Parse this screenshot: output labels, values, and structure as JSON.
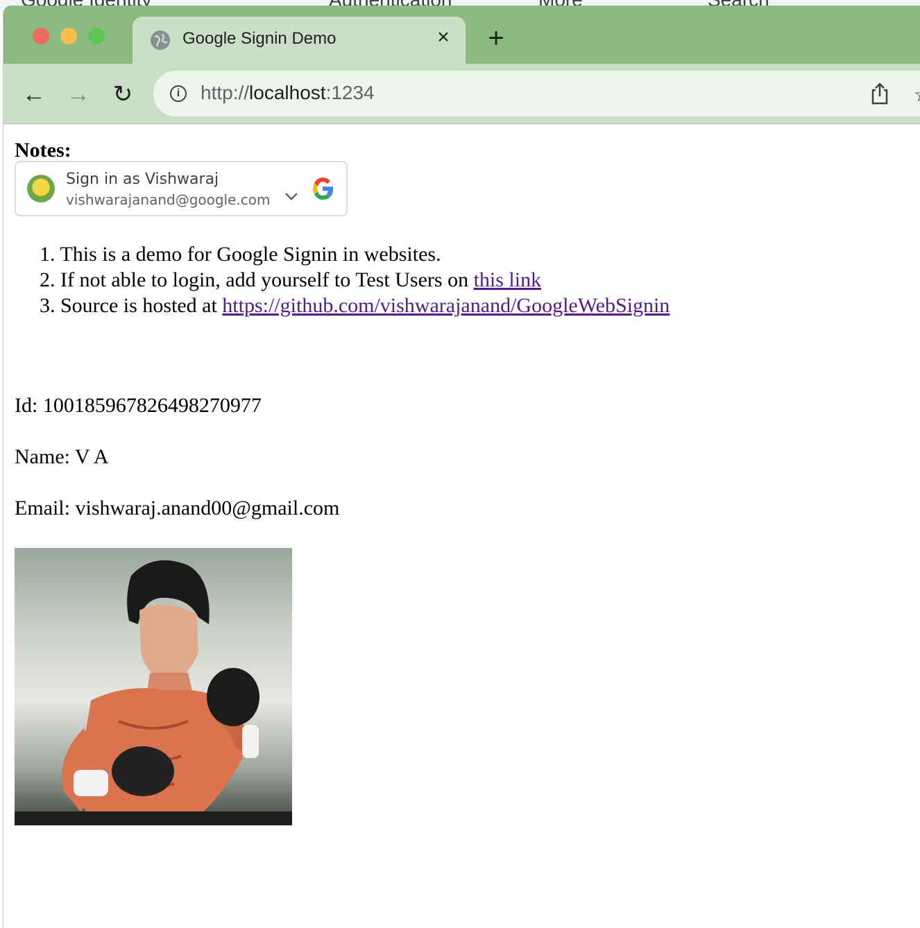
{
  "background_page": {
    "items": [
      "Google Identity",
      "Authentication",
      "More",
      "Search"
    ]
  },
  "browser": {
    "tab": {
      "title": "Google Signin Demo",
      "close_icon": "×",
      "new_tab_icon": "+"
    },
    "toolbar": {
      "back_icon": "←",
      "forward_icon": "→",
      "reload_icon": "↻",
      "url_scheme": "http://",
      "url_host": "localhost",
      "url_port": ":1234",
      "star_icon": "☆"
    }
  },
  "page": {
    "notes_heading": "Notes:",
    "signin_card": {
      "title": "Sign in as Vishwaraj",
      "email": "vishwarajanand@google.com",
      "chevron": "⌄"
    },
    "notes": [
      {
        "number": "1.",
        "text": "This is a demo for Google Signin in websites."
      },
      {
        "number": "2.",
        "text": "If not able to login, add yourself to Test Users on ",
        "link": "this link"
      },
      {
        "number": "3.",
        "text": "Source is hosted at ",
        "link": "https://github.com/vishwarajanand/GoogleWebSignin"
      }
    ],
    "id_line": "Id: 100185967826498270977",
    "name_line": "Name: V A",
    "email_line": "Email: vishwaraj.anand00@gmail.com"
  },
  "colors": {
    "tabbar": "#8aba80",
    "active_tab": "#c9e0c6",
    "omnibox": "#eef5ec",
    "link_visited": "#551a8b"
  }
}
